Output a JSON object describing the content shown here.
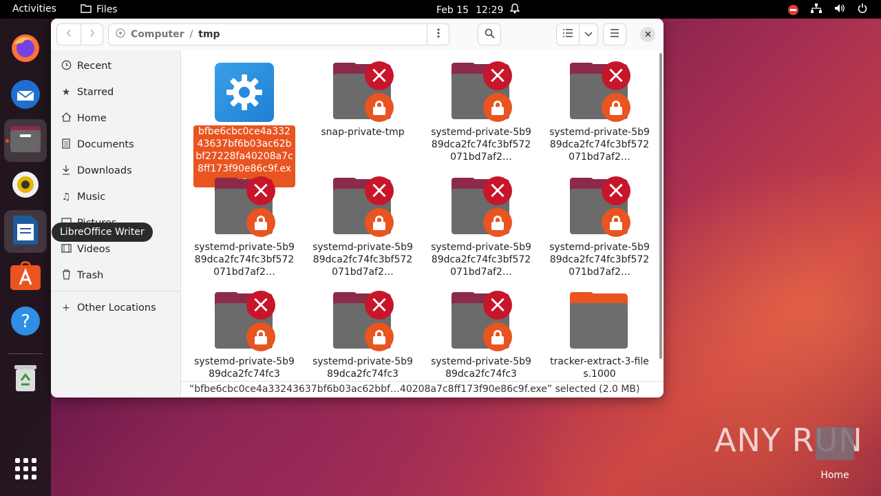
{
  "topbar": {
    "activities": "Activities",
    "app_name": "Files",
    "date": "Feb 15",
    "time": "12:29"
  },
  "tooltip": "LibreOffice Writer",
  "headerbar": {
    "path": [
      "Computer",
      "/",
      "tmp"
    ]
  },
  "sidebar": {
    "items": [
      {
        "label": "Recent",
        "icon": "clock-icon"
      },
      {
        "label": "Starred",
        "icon": "star-icon"
      },
      {
        "label": "Home",
        "icon": "home-icon"
      },
      {
        "label": "Documents",
        "icon": "document-icon"
      },
      {
        "label": "Downloads",
        "icon": "download-icon"
      },
      {
        "label": "Music",
        "icon": "music-icon"
      },
      {
        "label": "Pictures",
        "icon": "picture-icon"
      },
      {
        "label": "Videos",
        "icon": "video-icon"
      },
      {
        "label": "Trash",
        "icon": "trash-icon"
      }
    ],
    "other": "Other Locations"
  },
  "files": [
    {
      "name": "bfbe6cbc0ce4a33243637bf6b03ac62bbf27228fa40208a7c8ff173f90e86c9f.exe",
      "kind": "exe",
      "selected": true
    },
    {
      "name": "snap-private-tmp",
      "kind": "locked"
    },
    {
      "name": "systemd-private-5b989dca2fc74fc3bf572071bd7af2…",
      "kind": "locked"
    },
    {
      "name": "systemd-private-5b989dca2fc74fc3bf572071bd7af2…",
      "kind": "locked"
    },
    {
      "name": "systemd-private-5b989dca2fc74fc3bf572071bd7af2…",
      "kind": "locked"
    },
    {
      "name": "systemd-private-5b989dca2fc74fc3bf572071bd7af2…",
      "kind": "locked"
    },
    {
      "name": "systemd-private-5b989dca2fc74fc3bf572071bd7af2…",
      "kind": "locked"
    },
    {
      "name": "systemd-private-5b989dca2fc74fc3bf572071bd7af2…",
      "kind": "locked"
    },
    {
      "name": "systemd-private-5b989dca2fc74fc3",
      "kind": "locked"
    },
    {
      "name": "systemd-private-5b989dca2fc74fc3",
      "kind": "locked"
    },
    {
      "name": "systemd-private-5b989dca2fc74fc3",
      "kind": "locked"
    },
    {
      "name": "tracker-extract-3-files.1000",
      "kind": "folder"
    }
  ],
  "status": "“bfbe6cbc0ce4a33243637bf6b03ac62bbf…40208a7c8ff173f90e86c9f.exe” selected  (2.0 MB)",
  "desktop": {
    "home_label": "Home",
    "watermark": "ANY RUN"
  }
}
